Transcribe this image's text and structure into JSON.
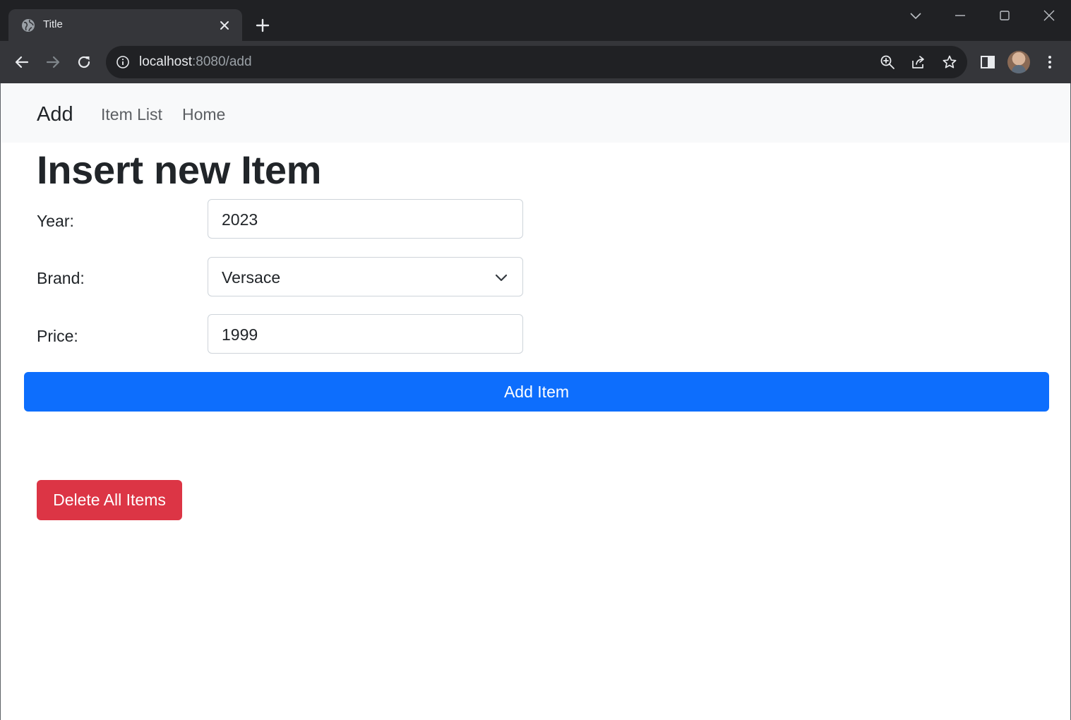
{
  "browser": {
    "tab": {
      "title": "Title"
    },
    "address_bar": {
      "host": "localhost",
      "rest": ":8080/add"
    }
  },
  "navbar": {
    "brand": "Add",
    "links": [
      {
        "label": "Item List"
      },
      {
        "label": "Home"
      }
    ]
  },
  "form": {
    "heading": "Insert new Item",
    "year": {
      "label": "Year:",
      "value": "2023"
    },
    "brand": {
      "label": "Brand:",
      "selected": "Versace"
    },
    "price": {
      "label": "Price:",
      "value": "1999"
    },
    "submit_label": "Add Item"
  },
  "delete_all_label": "Delete All Items",
  "colors": {
    "primary": "#0d6efd",
    "danger": "#dc3545",
    "navbar_bg": "#f8f9fa",
    "chrome_dark": "#202124",
    "chrome_toolbar": "#35363a"
  }
}
